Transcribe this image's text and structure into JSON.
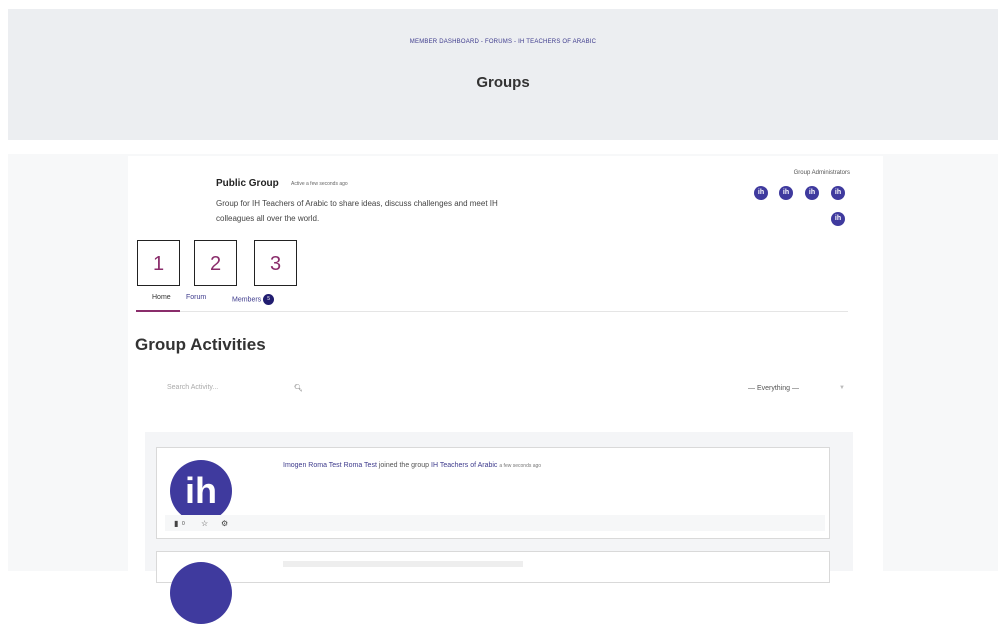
{
  "breadcrumb": [
    "MEMBER DASHBOARD",
    "FORUMS",
    "IH TEACHERS OF ARABIC"
  ],
  "breadcrumb_sep": " - ",
  "page_title": "Groups",
  "group": {
    "title": "Public Group",
    "active": "Active a few seconds ago",
    "description": "Group for IH Teachers of Arabic to share ideas, discuss challenges and meet IH colleagues all over the world."
  },
  "admins": {
    "label": "Group Administrators",
    "avatar_text": "ih"
  },
  "markers": [
    "1",
    "2",
    "3"
  ],
  "tabs": [
    {
      "label": "Home"
    },
    {
      "label": "Forum"
    },
    {
      "label": "Members",
      "badge": "5"
    }
  ],
  "section_title": "Group Activities",
  "search": {
    "placeholder": "Search Activity..."
  },
  "filter": {
    "value": "— Everything —"
  },
  "activity": {
    "avatar_text": "ih",
    "actor": "Imogen Roma Test Roma Test",
    "action": "joined the group",
    "group": "IH Teachers of Arabic",
    "time": "a few seconds ago",
    "comment_count": "0"
  },
  "colors": {
    "brand": "#3f3a9e",
    "accent": "#8a2d6b",
    "hero_bg": "#eceef1"
  }
}
